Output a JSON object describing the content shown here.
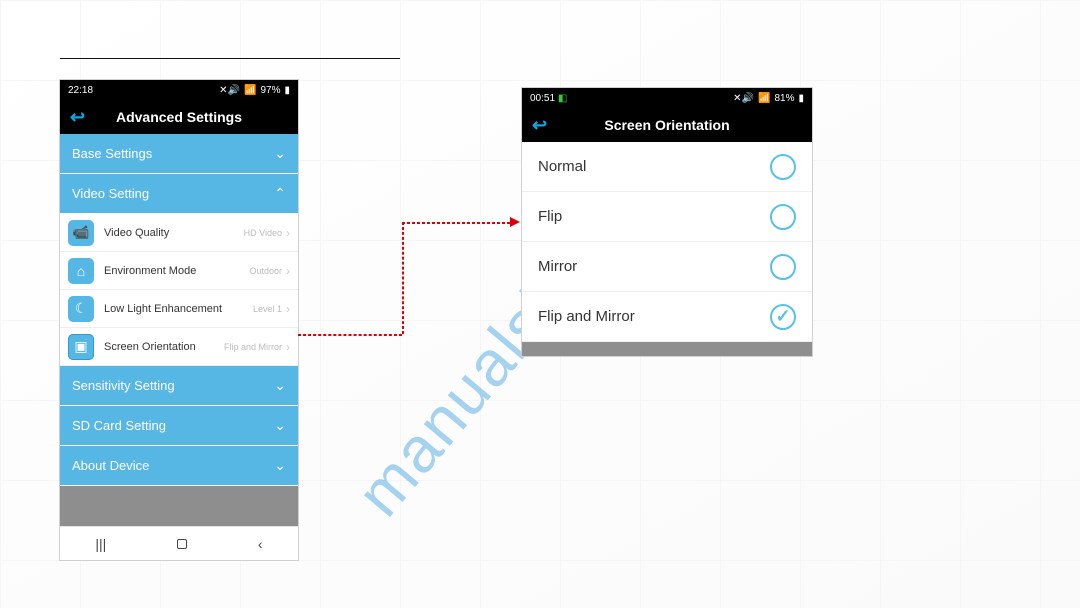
{
  "watermark": "manualshive.com",
  "phone1": {
    "status": {
      "time": "22:18",
      "battery": "97%"
    },
    "title": "Advanced Settings",
    "sections": {
      "base": {
        "label": "Base Settings"
      },
      "video": {
        "label": "Video Setting"
      },
      "sensitivity": {
        "label": "Sensitivity Setting"
      },
      "sdcard": {
        "label": "SD Card Setting"
      },
      "about": {
        "label": "About Device"
      }
    },
    "rows": {
      "quality": {
        "label": "Video Quality",
        "value": "HD Video"
      },
      "env": {
        "label": "Environment Mode",
        "value": "Outdoor"
      },
      "lowlight": {
        "label": "Low Light Enhancement",
        "value": "Level 1"
      },
      "orientation": {
        "label": "Screen Orientation",
        "value": "Flip and Mirror"
      }
    }
  },
  "phone2": {
    "status": {
      "time": "00:51",
      "battery": "81%"
    },
    "title": "Screen Orientation",
    "options": {
      "normal": {
        "label": "Normal",
        "selected": false
      },
      "flip": {
        "label": "Flip",
        "selected": false
      },
      "mirror": {
        "label": "Mirror",
        "selected": false
      },
      "flipmirror": {
        "label": "Flip and Mirror",
        "selected": true
      }
    }
  }
}
